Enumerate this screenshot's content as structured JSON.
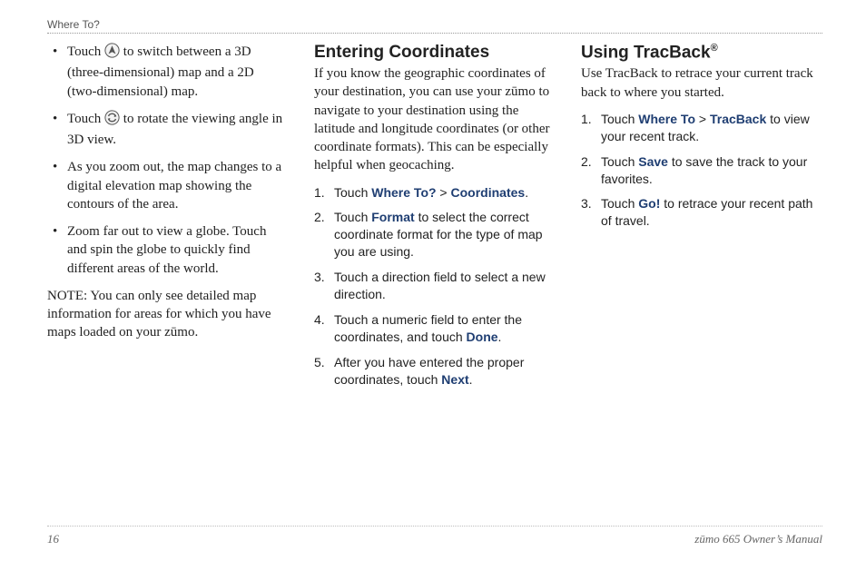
{
  "header": {
    "section": "Where To?"
  },
  "col1": {
    "bullets": [
      {
        "pre": "Touch ",
        "icon": "3d-toggle-icon",
        "post": " to switch between a 3D (three‑dimensional) map and a 2D (two‑dimensional) map."
      },
      {
        "pre": "Touch ",
        "icon": "rotate-icon",
        "post": " to rotate the viewing angle in 3D view."
      },
      {
        "pre": "",
        "icon": null,
        "post": "As you zoom out, the map changes to a digital elevation map showing the contours of the area."
      },
      {
        "pre": "",
        "icon": null,
        "post": "Zoom far out to view a globe. Touch and spin the globe to quickly find different areas of the world."
      }
    ],
    "note": "NOTE: You can only see detailed map information for areas for which you have maps loaded on your zūmo."
  },
  "col2": {
    "heading": "Entering Coordinates",
    "intro": "If you know the geographic coordinates of your destination, you can use your zūmo to navigate to your destination using the latitude and longitude coordinates (or other coordinate formats). This can be especially helpful when geocaching.",
    "steps": [
      [
        {
          "t": "Touch "
        },
        {
          "k": "Where To?"
        },
        {
          "t": " > "
        },
        {
          "k": "Coordinates"
        },
        {
          "t": "."
        }
      ],
      [
        {
          "t": "Touch "
        },
        {
          "k": "Format"
        },
        {
          "t": " to select the correct coordinate format for the type of map you are using."
        }
      ],
      [
        {
          "t": "Touch a direction field to select a new direction."
        }
      ],
      [
        {
          "t": "Touch a numeric field to enter the coordinates, and touch "
        },
        {
          "k": "Done"
        },
        {
          "t": "."
        }
      ],
      [
        {
          "t": "After you have entered the proper coordinates, touch "
        },
        {
          "k": "Next"
        },
        {
          "t": "."
        }
      ]
    ]
  },
  "col3": {
    "heading": "Using TracBack",
    "heading_sup": "®",
    "intro": "Use TracBack to retrace your current track back to where you started.",
    "steps": [
      [
        {
          "t": "Touch "
        },
        {
          "k": "Where To"
        },
        {
          "t": " > "
        },
        {
          "k": "TracBack"
        },
        {
          "t": " to view your recent track."
        }
      ],
      [
        {
          "t": "Touch "
        },
        {
          "k": "Save"
        },
        {
          "t": " to save the track to your favorites."
        }
      ],
      [
        {
          "t": "Touch "
        },
        {
          "k": "Go!"
        },
        {
          "t": " to retrace your recent path of travel."
        }
      ]
    ]
  },
  "footer": {
    "page": "16",
    "manual": "zūmo 665 Owner’s Manual"
  },
  "icons": {
    "3d-toggle-icon": "N-in-circle",
    "rotate-icon": "arrows-in-circle"
  }
}
